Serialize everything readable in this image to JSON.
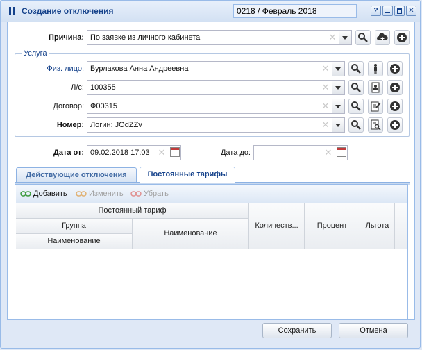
{
  "window": {
    "title": "Создание отключения",
    "period": "0218 / Февраль 2018",
    "help": "?"
  },
  "reason": {
    "label": "Причина:",
    "value": "По заявке из личного кабинета"
  },
  "service": {
    "legend": "Услуга",
    "person_label": "Физ. лицо:",
    "person_value": "Бурлакова Анна Андреевна",
    "account_label": "Л/с:",
    "account_value": "100355",
    "contract_label": "Договор:",
    "contract_value": "Ф00315",
    "number_label": "Номер:",
    "number_value": "Логин: JOdZZv"
  },
  "dates": {
    "from_label": "Дата от:",
    "from_value": "09.02.2018 17:03",
    "to_label": "Дата до:",
    "to_value": ""
  },
  "tabs": [
    {
      "label": "Действующие отключения"
    },
    {
      "label": "Постоянные тарифы"
    }
  ],
  "toolbar": {
    "add": "Добавить",
    "edit": "Изменить",
    "remove": "Убрать"
  },
  "grid": {
    "group_header": "Постоянный тариф",
    "group": "Группа",
    "group_name": "Наименование",
    "name": "Наименование",
    "quantity": "Количеств...",
    "percent": "Процент",
    "benefit": "Льгота"
  },
  "footer": {
    "save": "Сохранить",
    "cancel": "Отмена"
  }
}
